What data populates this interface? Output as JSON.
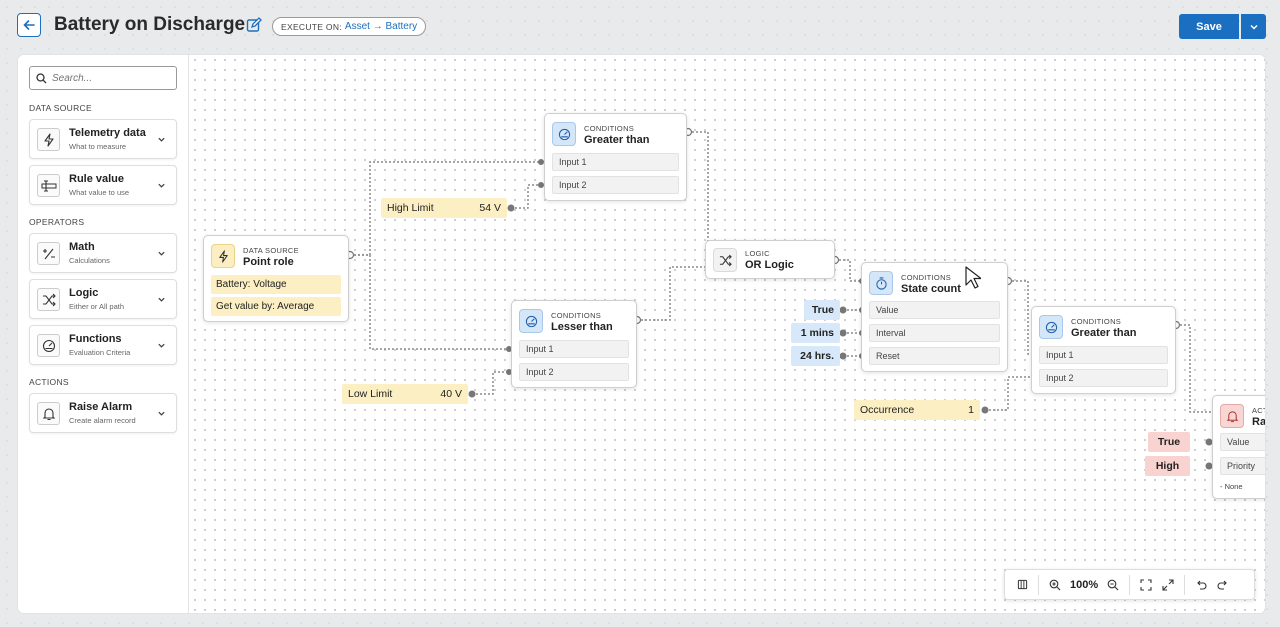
{
  "header": {
    "title": "Battery on Discharge",
    "execute_on_label": "EXECUTE ON:",
    "execute_on_value": "Asset → Battery",
    "save_label": "Save"
  },
  "sidebar": {
    "search_placeholder": "Search...",
    "sections": [
      {
        "label": "DATA SOURCE"
      },
      {
        "label": "OPERATORS"
      },
      {
        "label": "ACTIONS"
      }
    ],
    "items": [
      {
        "title": "Telemetry data",
        "subtitle": "What to measure",
        "icon": "lightning-icon"
      },
      {
        "title": "Rule value",
        "subtitle": "What value to use",
        "icon": "rule-value-icon"
      },
      {
        "title": "Math",
        "subtitle": "Calculations",
        "icon": "math-icon"
      },
      {
        "title": "Logic",
        "subtitle": "Either or All path",
        "icon": "shuffle-icon"
      },
      {
        "title": "Functions",
        "subtitle": "Evaluation Criteria",
        "icon": "gauge-icon"
      },
      {
        "title": "Raise Alarm",
        "subtitle": "Create alarm record",
        "icon": "bell-icon"
      }
    ]
  },
  "canvas": {
    "datasource_node": {
      "category": "DATA SOURCE",
      "name": "Point role",
      "field1": "Battery: Voltage",
      "field2": "Get value by: Average"
    },
    "greater_node_1": {
      "category": "CONDITIONS",
      "name": "Greater than",
      "input1": "Input 1",
      "input2": "Input 2"
    },
    "lesser_node": {
      "category": "CONDITIONS",
      "name": "Lesser than",
      "input1": "Input 1",
      "input2": "Input 2"
    },
    "logic_node": {
      "category": "LOGIC",
      "name": "OR Logic"
    },
    "state_count_node": {
      "category": "CONDITIONS",
      "name": "State count",
      "value": "Value",
      "interval": "Interval",
      "reset": "Reset"
    },
    "greater_node_2": {
      "category": "CONDITIONS",
      "name": "Greater than",
      "input1": "Input 1",
      "input2": "Input 2"
    },
    "alarm_node": {
      "category": "ACT",
      "name": "Ra",
      "value": "Value",
      "priority": "Priority",
      "none": "- None"
    },
    "high_limit": {
      "label": "High Limit",
      "value": "54 V"
    },
    "low_limit": {
      "label": "Low Limit",
      "value": "40 V"
    },
    "occurrence": {
      "label": "Occurrence",
      "value": "1"
    },
    "state_inputs": [
      "True",
      "1 mins",
      "24 hrs."
    ],
    "alarm_inputs": [
      "True",
      "High"
    ]
  },
  "toolbar": {
    "zoom": "100%"
  },
  "colors": {
    "accent": "#1b6fc0",
    "yellow_chip": "#fcefc4",
    "blue_chip": "#d6e8f9",
    "red_chip": "#f8d3d0"
  }
}
